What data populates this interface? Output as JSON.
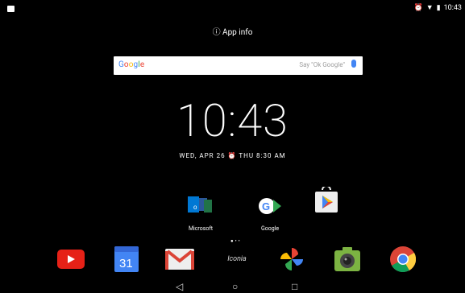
{
  "status": {
    "time": "10:43"
  },
  "header": {
    "app_info_label": "App info"
  },
  "search": {
    "logo": "Google",
    "hint": "Say \"Ok Google\""
  },
  "clock": {
    "time": "10:43"
  },
  "date": {
    "date": "WED, APR 26",
    "alarm": "THU 8:30 AM"
  },
  "apps": [
    {
      "label": "Microsoft"
    },
    {
      "label": "Google"
    },
    {
      "label": ""
    }
  ],
  "dock": [
    {
      "name": "YouTube"
    },
    {
      "name": "Calendar",
      "text": "31"
    },
    {
      "name": "Gmail"
    },
    {
      "name": "Iconia",
      "text": "Iconia"
    },
    {
      "name": "Photos"
    },
    {
      "name": "Camera"
    },
    {
      "name": "Chrome"
    }
  ],
  "colors": {
    "google_blue": "#4285f4",
    "google_red": "#ea4335",
    "google_yellow": "#fbbc05",
    "google_green": "#34a853"
  }
}
